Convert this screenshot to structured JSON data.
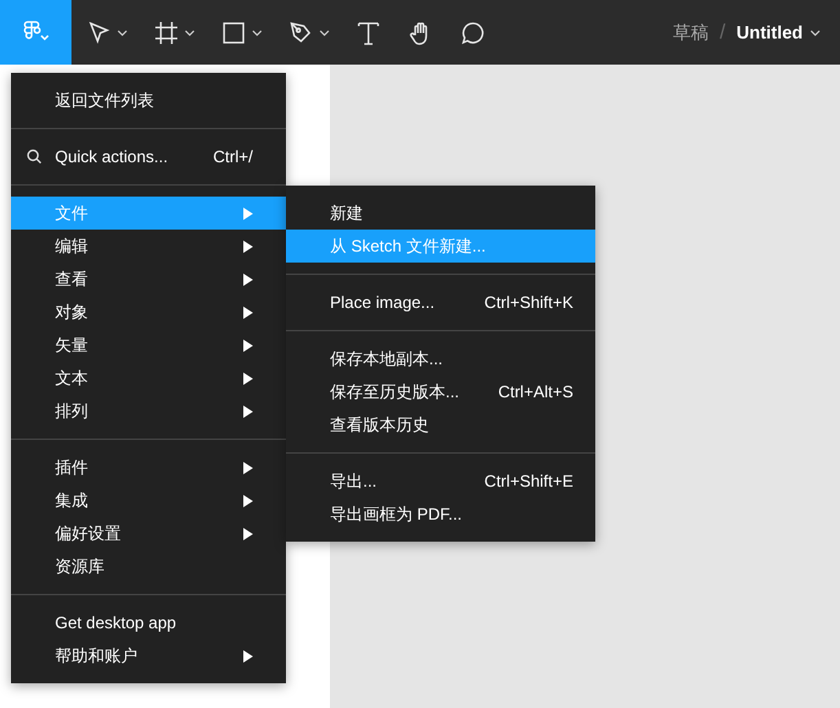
{
  "toolbar": {
    "main_menu_button": {
      "selected": true
    },
    "tools": [
      {
        "kind": "move",
        "selected": false
      },
      {
        "kind": "frame",
        "selected": false
      },
      {
        "kind": "rectangle",
        "selected": false
      },
      {
        "kind": "pen",
        "selected": false
      },
      {
        "kind": "text",
        "selected": false
      },
      {
        "kind": "hand",
        "selected": false
      },
      {
        "kind": "comment",
        "selected": false
      }
    ],
    "breadcrumb": {
      "folder": "草稿",
      "separator": "/",
      "file": "Untitled"
    }
  },
  "main_menu": {
    "items": [
      {
        "kind": "item",
        "label": "返回文件列表",
        "selected": false,
        "submenu": false
      },
      {
        "kind": "separator"
      },
      {
        "kind": "search",
        "label": "Quick actions...",
        "shortcut": "Ctrl+/",
        "selected": false,
        "submenu": false
      },
      {
        "kind": "separator"
      },
      {
        "kind": "item",
        "label": "文件",
        "selected": true,
        "submenu": true
      },
      {
        "kind": "item",
        "label": "编辑",
        "selected": false,
        "submenu": true
      },
      {
        "kind": "item",
        "label": "查看",
        "selected": false,
        "submenu": true
      },
      {
        "kind": "item",
        "label": "对象",
        "selected": false,
        "submenu": true
      },
      {
        "kind": "item",
        "label": "矢量",
        "selected": false,
        "submenu": true
      },
      {
        "kind": "item",
        "label": "文本",
        "selected": false,
        "submenu": true
      },
      {
        "kind": "item",
        "label": "排列",
        "selected": false,
        "submenu": true
      },
      {
        "kind": "separator"
      },
      {
        "kind": "item",
        "label": "插件",
        "selected": false,
        "submenu": true
      },
      {
        "kind": "item",
        "label": "集成",
        "selected": false,
        "submenu": true
      },
      {
        "kind": "item",
        "label": "偏好设置",
        "selected": false,
        "submenu": true
      },
      {
        "kind": "item",
        "label": "资源库",
        "selected": false,
        "submenu": false
      },
      {
        "kind": "separator"
      },
      {
        "kind": "item",
        "label": "Get desktop app",
        "selected": false,
        "submenu": false
      },
      {
        "kind": "item",
        "label": "帮助和账户",
        "selected": false,
        "submenu": true
      }
    ]
  },
  "file_submenu": {
    "items": [
      {
        "kind": "item",
        "label": "新建",
        "selected": false
      },
      {
        "kind": "item",
        "label": "从 Sketch 文件新建...",
        "selected": true
      },
      {
        "kind": "separator"
      },
      {
        "kind": "item",
        "label": "Place image...",
        "shortcut": "Ctrl+Shift+K",
        "selected": false
      },
      {
        "kind": "separator"
      },
      {
        "kind": "item",
        "label": "保存本地副本...",
        "selected": false
      },
      {
        "kind": "item",
        "label": "保存至历史版本...",
        "shortcut": "Ctrl+Alt+S",
        "selected": false
      },
      {
        "kind": "item",
        "label": "查看版本历史",
        "selected": false
      },
      {
        "kind": "separator"
      },
      {
        "kind": "item",
        "label": "导出...",
        "shortcut": "Ctrl+Shift+E",
        "selected": false
      },
      {
        "kind": "item",
        "label": "导出画框为 PDF...",
        "selected": false
      }
    ]
  }
}
